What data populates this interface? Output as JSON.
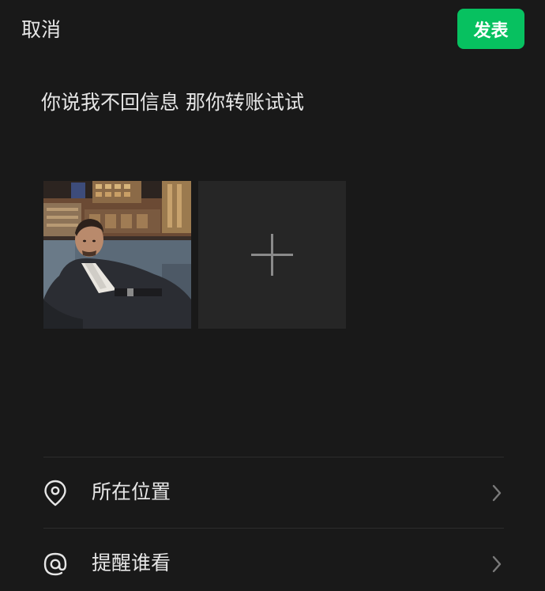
{
  "topbar": {
    "cancel_label": "取消",
    "publish_label": "发表"
  },
  "post": {
    "text": "你说我不回信息 那你转账试试"
  },
  "media": {
    "items": [
      {
        "kind": "image",
        "description_icon": "photo-thumbnail"
      }
    ],
    "add_icon": "plus-icon"
  },
  "options": [
    {
      "label": "所在位置",
      "icon": "location-pin-icon",
      "chevron": "chevron-right-icon"
    },
    {
      "label": "提醒谁看",
      "icon": "at-sign-icon",
      "chevron": "chevron-right-icon"
    }
  ],
  "colors": {
    "background": "#191919",
    "accent": "#07c160",
    "text": "#e6e6e6",
    "tile": "#262626",
    "divider": "#2c2c2c"
  }
}
